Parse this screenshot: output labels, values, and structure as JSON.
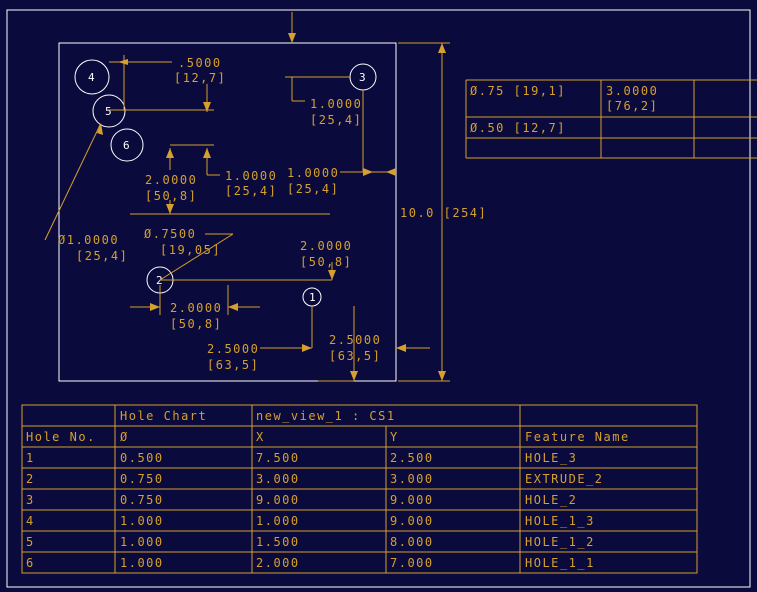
{
  "colors": {
    "background": "#0a0a3c",
    "dimension": "#d6a02c",
    "geometry": "#ffffff"
  },
  "holes": [
    {
      "id": "4",
      "label": "4"
    },
    {
      "id": "5",
      "label": "5"
    },
    {
      "id": "6",
      "label": "6"
    },
    {
      "id": "3",
      "label": "3"
    },
    {
      "id": "2",
      "label": "2"
    },
    {
      "id": "1",
      "label": "1"
    }
  ],
  "dimensions": {
    "d_top_in": ".5000",
    "d_top_mm": "[12,7]",
    "d_h3_in": "1.0000",
    "d_h3_mm": "[25,4]",
    "d_mid1_in": "1.0000",
    "d_mid1_mm": "[25,4]",
    "d_mid2_in": "1.0000",
    "d_mid2_mm": "[25,4]",
    "d_left_in": "2.0000",
    "d_left_mm": "[50,8]",
    "d_dia1_in": "Ø1.0000",
    "d_dia1_mm": "[25,4]",
    "d_dia75_in": "Ø.7500",
    "d_dia75_mm": "[19,05]",
    "d_right2_in": "2.0000",
    "d_right2_mm": "[50,8]",
    "d_bot2_in": "2.0000",
    "d_bot2_mm": "[50,8]",
    "d_bl25_in": "2.5000",
    "d_bl25_mm": "[63,5]",
    "d_br25_in": "2.5000",
    "d_br25_mm": "[63,5]",
    "d_height": "10.0 [254]"
  },
  "side_table": {
    "rows": [
      [
        "Ø.75 [19,1]",
        "3.0000",
        "[76,2]"
      ],
      [
        "Ø.50 [12,7]",
        "",
        ""
      ],
      [
        "",
        "",
        ""
      ]
    ]
  },
  "hole_chart": {
    "title_row": [
      "",
      "Hole Chart",
      "new_view_1 : CS1",
      "",
      ""
    ],
    "headers": [
      "Hole No.",
      "Ø",
      "X",
      "Y",
      "Feature Name"
    ],
    "rows": [
      [
        "1",
        "0.500",
        "7.500",
        "2.500",
        "HOLE_3"
      ],
      [
        "2",
        "0.750",
        "3.000",
        "3.000",
        "EXTRUDE_2"
      ],
      [
        "3",
        "0.750",
        "9.000",
        "9.000",
        "HOLE_2"
      ],
      [
        "4",
        "1.000",
        "1.000",
        "9.000",
        "HOLE_1_3"
      ],
      [
        "5",
        "1.000",
        "1.500",
        "8.000",
        "HOLE_1_2"
      ],
      [
        "6",
        "1.000",
        "2.000",
        "7.000",
        "HOLE_1_1"
      ]
    ]
  }
}
